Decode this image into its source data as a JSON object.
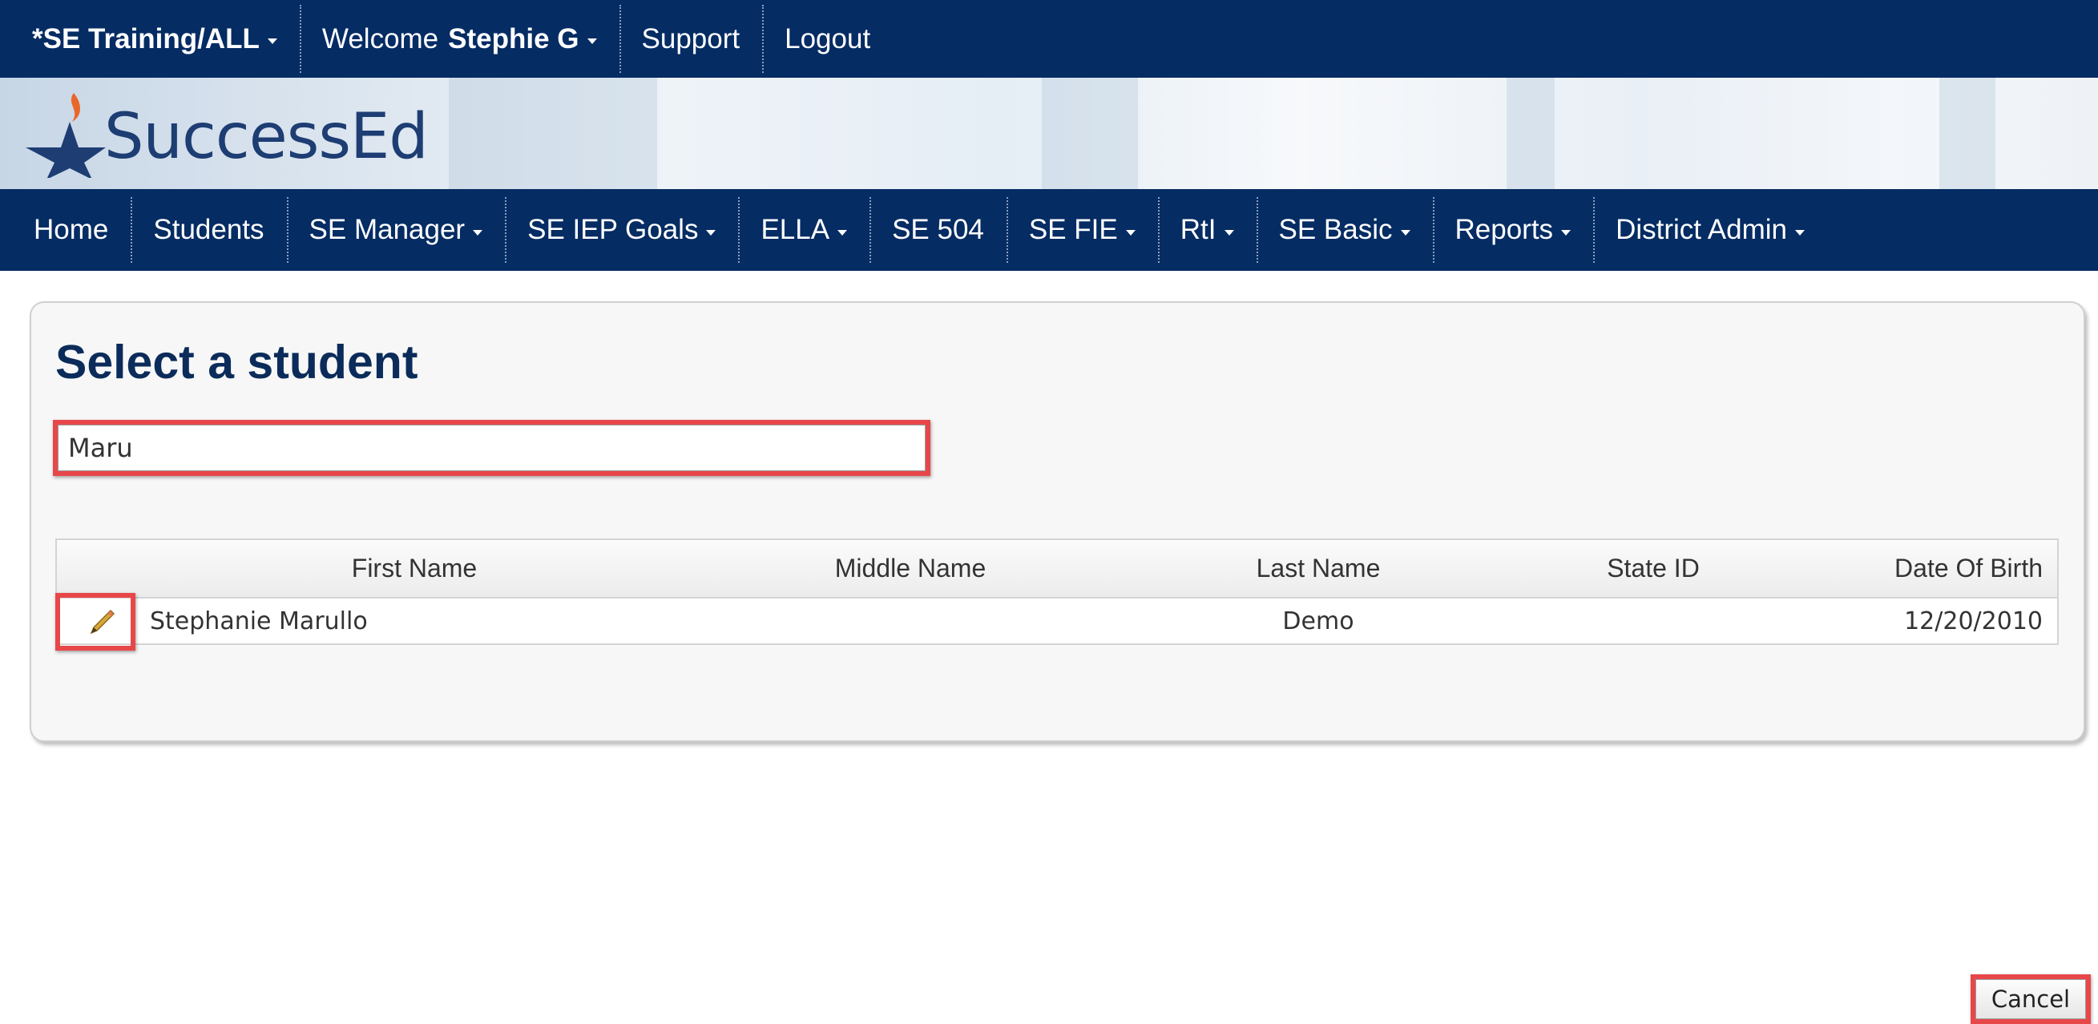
{
  "topbar": {
    "items": [
      {
        "label": "*SE Training/ALL",
        "caret": true
      },
      {
        "prefix": "Welcome",
        "name": "Stephie G",
        "caret": true
      },
      {
        "label": "Support"
      },
      {
        "label": "Logout"
      }
    ]
  },
  "brand": {
    "logo_text": "SuccessEd",
    "colors": {
      "star": "#1d3d73",
      "flame": "#e8672a"
    }
  },
  "nav": {
    "items": [
      {
        "label": "Home"
      },
      {
        "label": "Students"
      },
      {
        "label": "SE Manager"
      },
      {
        "label": "SE IEP Goals"
      },
      {
        "label": "ELLA"
      },
      {
        "label": "SE 504"
      },
      {
        "label": "SE FIE"
      },
      {
        "label": "RtI"
      },
      {
        "label": "SE Basic"
      },
      {
        "label": "Reports"
      },
      {
        "label": "District Admin"
      }
    ]
  },
  "panel": {
    "title": "Select a student",
    "search": {
      "value": "Maru"
    },
    "table": {
      "headers": [
        "First Name",
        "Middle Name",
        "Last Name",
        "State ID",
        "Date Of Birth"
      ],
      "rows": [
        {
          "first_name": "Stephanie Marullo",
          "middle_name": "",
          "last_name": "Demo",
          "state_id": "",
          "dob": "12/20/2010",
          "action_icon": "pencil-icon"
        }
      ]
    },
    "cancel_label": "Cancel"
  },
  "colors": {
    "nav_bg": "#052c63",
    "title": "#0b2c5a",
    "highlight": "#e8474a"
  }
}
